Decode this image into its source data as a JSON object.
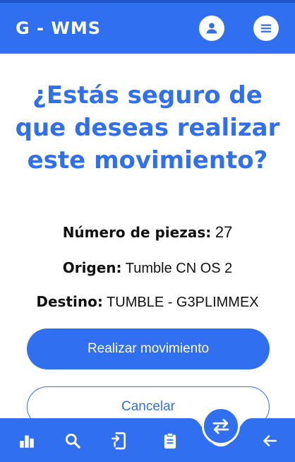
{
  "header": {
    "app_title": "G - WMS",
    "profile_icon": "account-circle-icon",
    "menu_icon": "menu-icon"
  },
  "confirm": {
    "question": "¿Estás seguro de que deseas realizar este movimiento?",
    "pieces_label": "Número de piezas:",
    "pieces_value": "27",
    "origin_label": "Origen:",
    "origin_value": "Tumble CN OS 2",
    "dest_label": "Destino:",
    "dest_value": "TUMBLE - G3PLIMMEX",
    "primary_button": "Realizar movimiento",
    "secondary_button": "Cancelar"
  },
  "bottom_nav": {
    "items": [
      {
        "icon": "bar-chart-icon"
      },
      {
        "icon": "search-icon"
      },
      {
        "icon": "phone-entry-icon"
      },
      {
        "icon": "clipboard-icon"
      },
      {
        "icon": "swap-arrows-icon",
        "active": true
      },
      {
        "icon": "back-arrow-icon"
      }
    ]
  },
  "colors": {
    "primary": "#2f6ff0",
    "text": "#111111",
    "background": "#ffffff"
  }
}
